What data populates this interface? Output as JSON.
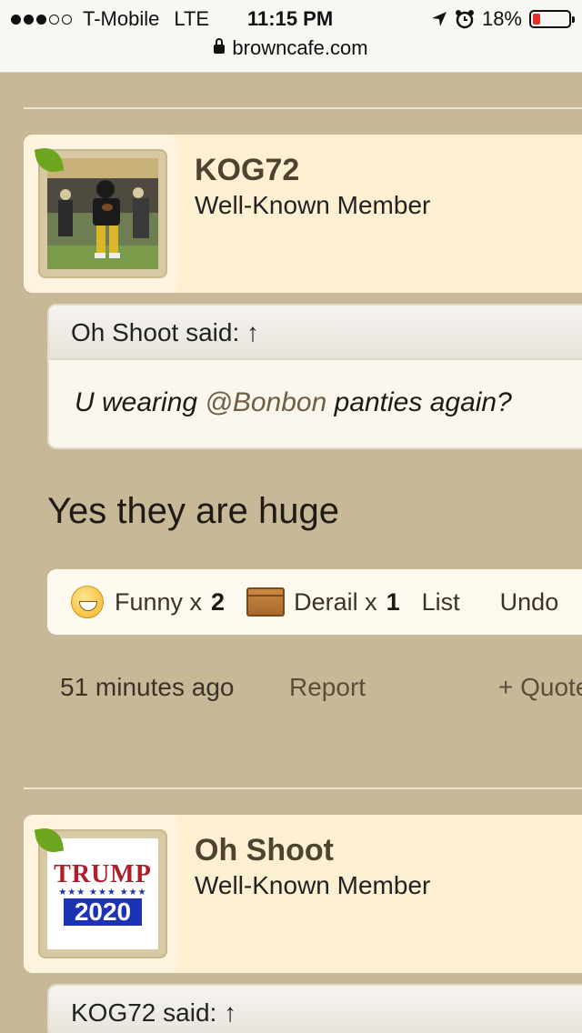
{
  "status_bar": {
    "carrier": "T-Mobile",
    "network": "LTE",
    "time": "11:15 PM",
    "battery": "18%",
    "battery_level": 0.18
  },
  "url_bar": {
    "domain": "browncafe.com"
  },
  "posts": [
    {
      "author": "KOG72",
      "role": "Well-Known Member",
      "quote": {
        "header": "Oh Shoot said: ↑",
        "text_before": "U wearing ",
        "mention": "@Bonbon",
        "text_after": " panties again?"
      },
      "message": "Yes they are huge",
      "reactions": {
        "funny_label": "Funny x",
        "funny_count": "2",
        "derail_label": "Derail x",
        "derail_count": "1",
        "list_label": "List",
        "undo_label": "Undo"
      },
      "timestamp": "51 minutes ago",
      "report_label": "Report",
      "quote_label": "+ Quote"
    },
    {
      "author": "Oh Shoot",
      "role": "Well-Known Member",
      "avatar_text_top": "TRUMP",
      "avatar_stars": "★★★ ★★★ ★★★",
      "avatar_text_bottom": "2020",
      "quote": {
        "header": "KOG72 said: ↑"
      }
    }
  ]
}
